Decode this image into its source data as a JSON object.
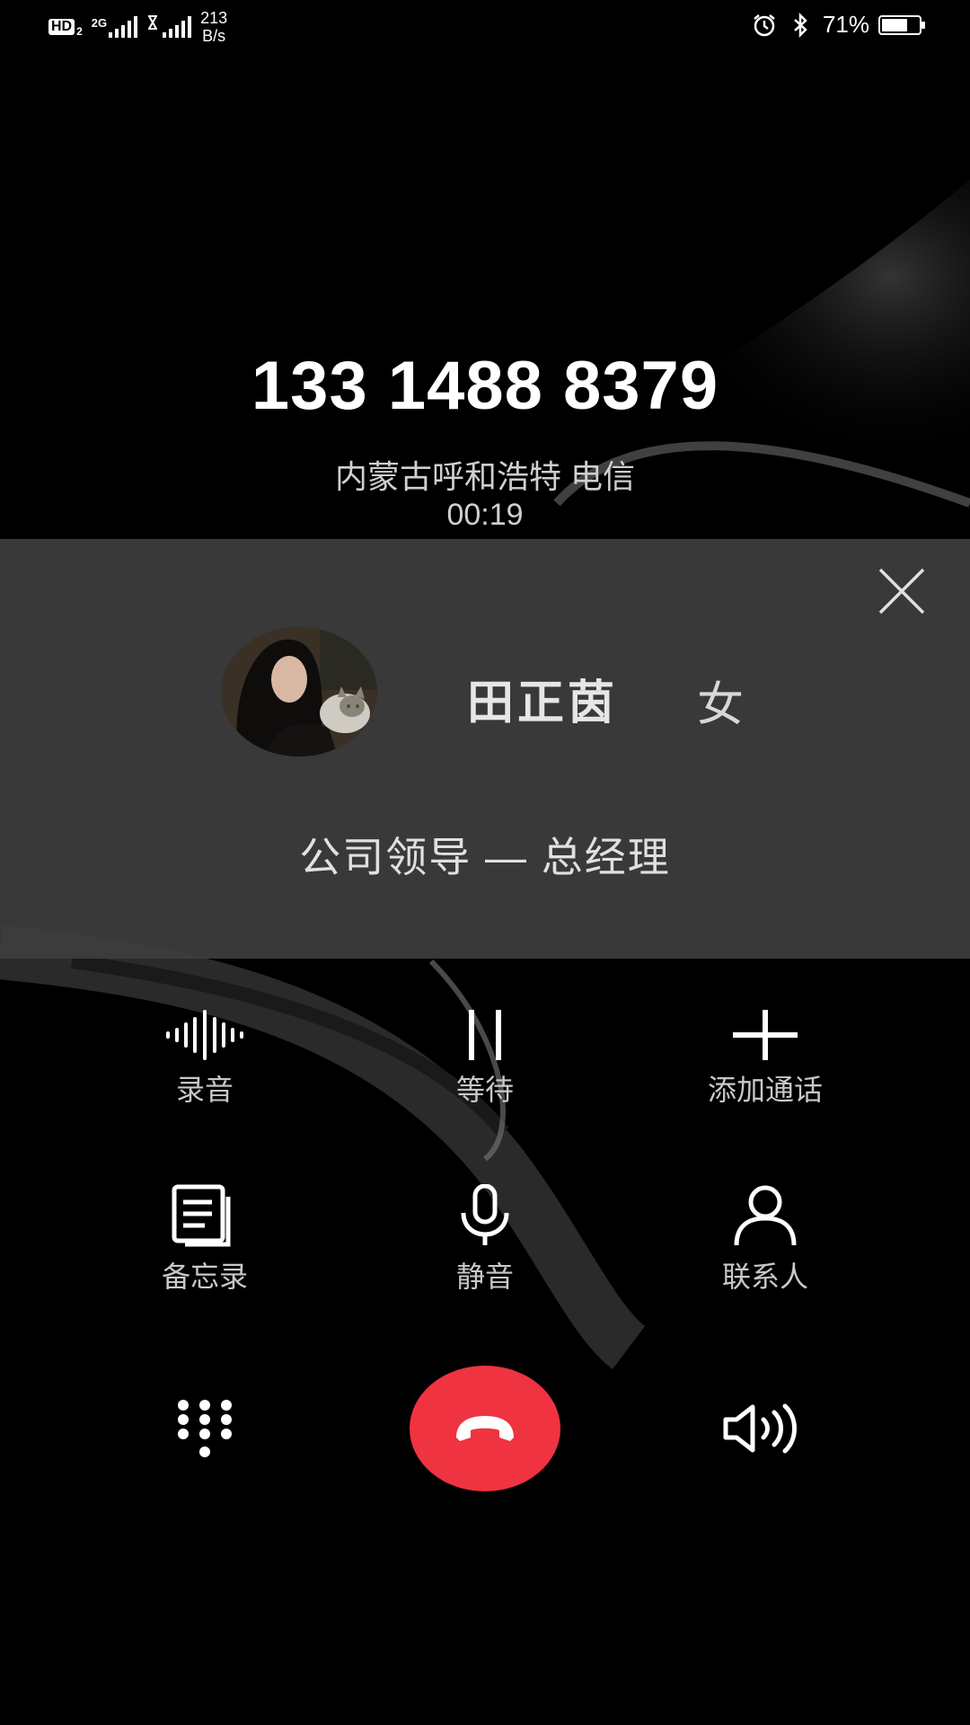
{
  "status_bar": {
    "hd_label": "HD",
    "hd_sub": "2",
    "network_type": "2G",
    "net_speed_value": "213",
    "net_speed_unit": "B/s",
    "battery_percent": "71%",
    "battery_level": 0.71,
    "icons": [
      "alarm-icon",
      "bluetooth-icon",
      "battery-icon"
    ]
  },
  "call": {
    "number": "133 1488 8379",
    "location": "内蒙古呼和浩特 电信",
    "duration": "00:19"
  },
  "contact_card": {
    "name": "田正茵",
    "gender": "女",
    "title": "公司领导 — 总经理"
  },
  "controls": {
    "record": "录音",
    "hold": "等待",
    "add_call": "添加通话",
    "notes": "备忘录",
    "mute": "静音",
    "contacts": "联系人"
  },
  "colors": {
    "end_call": "#ef3340",
    "card_bg": "#3e3e3e"
  }
}
